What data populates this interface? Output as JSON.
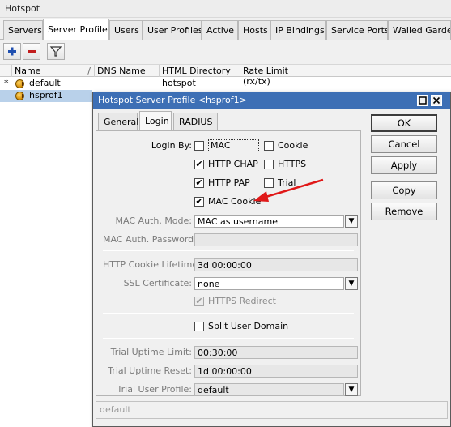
{
  "window": {
    "title": "Hotspot"
  },
  "tabs": [
    "Servers",
    "Server Profiles",
    "Users",
    "User Profiles",
    "Active",
    "Hosts",
    "IP Bindings",
    "Service Ports",
    "Walled Garden"
  ],
  "toolbar": {
    "add_icon": "plus-icon",
    "remove_icon": "minus-icon",
    "filter_icon": "funnel-icon"
  },
  "list": {
    "columns": [
      "Name",
      "DNS Name",
      "HTML Directory",
      "Rate Limit (rx/tx)"
    ],
    "rows": [
      {
        "marker": "*",
        "name": "default",
        "dns": "",
        "html_dir": "hotspot",
        "rate": ""
      },
      {
        "marker": "",
        "name": "hsprof1",
        "dns": "",
        "html_dir": "",
        "rate": ""
      }
    ]
  },
  "dialog": {
    "title": "Hotspot Server Profile <hsprof1>",
    "tabs": [
      "General",
      "Login",
      "RADIUS"
    ],
    "active_tab": "Login",
    "login_by_label": "Login By:",
    "options": {
      "mac": {
        "label": "MAC",
        "checked": false
      },
      "cookie": {
        "label": "Cookie",
        "checked": false
      },
      "http_chap": {
        "label": "HTTP CHAP",
        "checked": true
      },
      "https": {
        "label": "HTTPS",
        "checked": false
      },
      "http_pap": {
        "label": "HTTP PAP",
        "checked": true
      },
      "trial": {
        "label": "Trial",
        "checked": false
      },
      "mac_cookie": {
        "label": "MAC Cookie",
        "checked": true
      }
    },
    "mac_auth_mode_label": "MAC Auth. Mode:",
    "mac_auth_mode_value": "MAC as username",
    "mac_auth_password_label": "MAC Auth. Password:",
    "mac_auth_password_value": "",
    "http_cookie_lifetime_label": "HTTP Cookie Lifetime:",
    "http_cookie_lifetime_value": "3d 00:00:00",
    "ssl_certificate_label": "SSL Certificate:",
    "ssl_certificate_value": "none",
    "https_redirect": {
      "label": "HTTPS Redirect",
      "checked": true
    },
    "split_user_domain": {
      "label": "Split User Domain",
      "checked": false
    },
    "trial_uptime_limit_label": "Trial Uptime Limit:",
    "trial_uptime_limit_value": "00:30:00",
    "trial_uptime_reset_label": "Trial Uptime Reset:",
    "trial_uptime_reset_value": "1d 00:00:00",
    "trial_user_profile_label": "Trial User Profile:",
    "trial_user_profile_value": "default",
    "buttons": {
      "ok": "OK",
      "cancel": "Cancel",
      "apply": "Apply",
      "copy": "Copy",
      "remove": "Remove"
    },
    "status": "default"
  },
  "colors": {
    "title_bar": "#3d6fb5",
    "selection": "#b9d1ea",
    "arrow": "#e01818",
    "add": "#1f4fb0",
    "remove": "#c21d1d"
  }
}
